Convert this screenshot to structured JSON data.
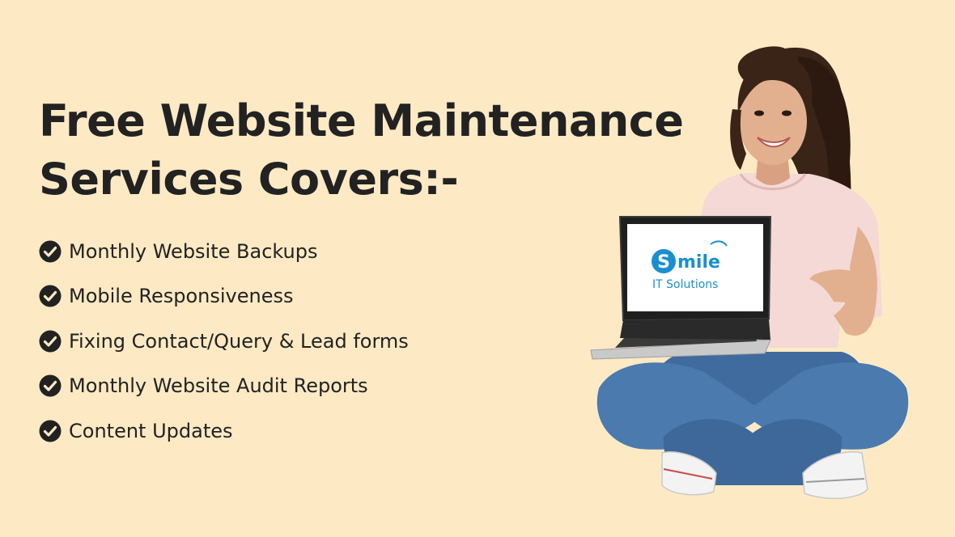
{
  "headline": {
    "line1": "Free Website Maintenance",
    "line2": "Services Covers:-"
  },
  "features": [
    {
      "icon": "check-circle-icon",
      "label": "Monthly Website Backups"
    },
    {
      "icon": "check-circle-icon",
      "label": "Mobile Responsiveness"
    },
    {
      "icon": "check-circle-icon",
      "label": "Fixing Contact/Query & Lead forms"
    },
    {
      "icon": "check-circle-icon",
      "label": "Monthly Website Audit Reports"
    },
    {
      "icon": "check-circle-icon",
      "label": "Content Updates"
    }
  ],
  "laptop_screen": {
    "logo_initial": "S",
    "logo_word": "mile",
    "logo_tagline": "IT Solutions"
  },
  "colors": {
    "background": "#fdeac4",
    "text": "#222222",
    "brand_blue": "#1a8fd0",
    "check_icon": "#222222"
  }
}
